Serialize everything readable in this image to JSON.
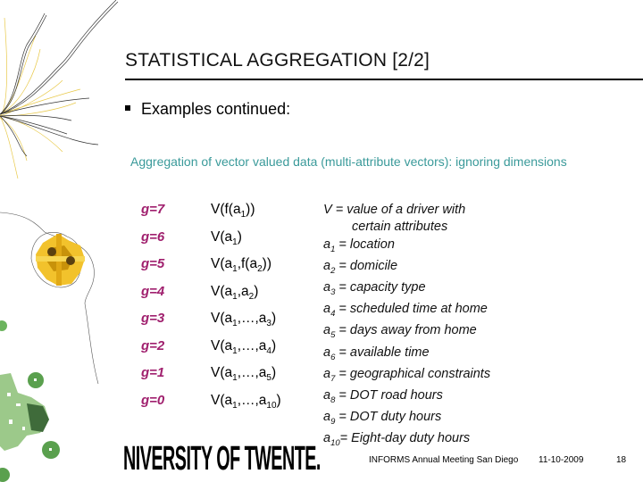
{
  "slide": {
    "title": "STATISTICAL AGGREGATION [2/2]",
    "bullet": "Examples continued:",
    "subtitle": "Aggregation of vector valued data (multi-attribute vectors): ignoring dimensions",
    "colors": {
      "title": "#111111",
      "subtitle": "#3a9a9a",
      "level_label": "#a0206e",
      "rule": "#000000"
    },
    "levels": [
      {
        "label": "g=7",
        "expr_parts": [
          "V(f(a",
          "1",
          "))"
        ]
      },
      {
        "label": "g=6",
        "expr_parts": [
          "V(a",
          "1",
          ")"
        ]
      },
      {
        "label": "g=5",
        "expr_parts": [
          "V(a",
          "1",
          ",f(a",
          "2",
          "))"
        ]
      },
      {
        "label": "g=4",
        "expr_parts": [
          "V(a",
          "1",
          ",a",
          "2",
          ")"
        ]
      },
      {
        "label": "g=3",
        "expr_parts": [
          "V(a",
          "1",
          ",…,a",
          "3",
          ")"
        ]
      },
      {
        "label": "g=2",
        "expr_parts": [
          "V(a",
          "1",
          ",…,a",
          "4",
          ")"
        ]
      },
      {
        "label": "g=1",
        "expr_parts": [
          "V(a",
          "1",
          ",…,a",
          "5",
          ")"
        ]
      },
      {
        "label": "g=0",
        "expr_parts": [
          "V(a",
          "1",
          ",…,a",
          "10",
          ")"
        ]
      }
    ],
    "legend": {
      "v_line1": "V =  value of a driver with",
      "v_line2": "certain attributes",
      "items": [
        {
          "sym": "a",
          "sub": "1",
          "desc": " = location"
        },
        {
          "sym": "a",
          "sub": "2",
          "desc": " = domicile"
        },
        {
          "sym": "a",
          "sub": "3",
          "desc": " = capacity type"
        },
        {
          "sym": "a",
          "sub": "4",
          "desc": " = scheduled time at home"
        },
        {
          "sym": "a",
          "sub": "5",
          "desc": " = days away from home"
        },
        {
          "sym": "a",
          "sub": "6",
          "desc": " = available time"
        },
        {
          "sym": "a",
          "sub": "7",
          "desc": " = geographical constraints"
        },
        {
          "sym": "a",
          "sub": "8",
          "desc": " = DOT road hours"
        },
        {
          "sym": "a",
          "sub": "9",
          "desc": " = DOT duty hours"
        },
        {
          "sym": "a",
          "sub": "10",
          "desc": "= Eight-day duty hours"
        }
      ]
    }
  },
  "footer": {
    "logo_text": "NIVERSITY OF TWENTE.",
    "conference": "INFORMS Annual Meeting San Diego",
    "date": "11-10-2009",
    "page": "18"
  },
  "decoration": {
    "icons": [
      "line-sketch-icon",
      "gold-polyhedron-icon",
      "green-lattice-icon"
    ]
  }
}
